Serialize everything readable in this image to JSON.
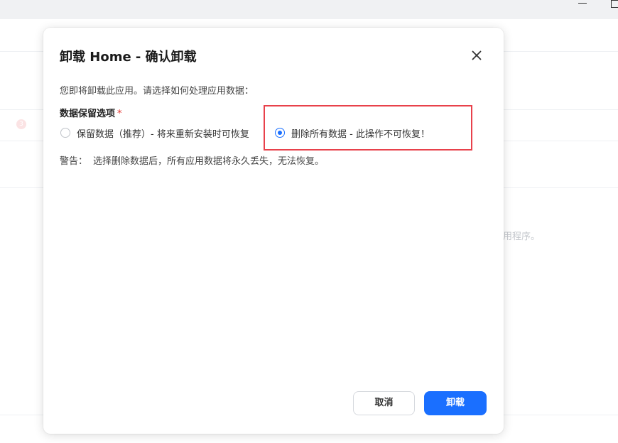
{
  "background": {
    "badge_text": "3",
    "partial_text": "用程序。"
  },
  "dialog": {
    "title": "卸载 Home - 确认卸载",
    "close_icon": "close-icon",
    "description": "您即将卸载此应用。请选择如何处理应用数据：",
    "section_label": "数据保留选项",
    "required_mark": "*",
    "options": [
      {
        "label": "保留数据（推荐）- 将来重新安装时可恢复",
        "selected": false
      },
      {
        "label": "删除所有数据 - 此操作不可恢复！",
        "selected": true
      }
    ],
    "warning_prefix": "警告：",
    "warning_text": "选择删除数据后，所有应用数据将永久丢失，无法恢复。",
    "cancel_label": "取消",
    "confirm_label": "卸载"
  },
  "colors": {
    "accent": "#1a6fff",
    "highlight": "#e8414b",
    "required": "#e2352f"
  }
}
